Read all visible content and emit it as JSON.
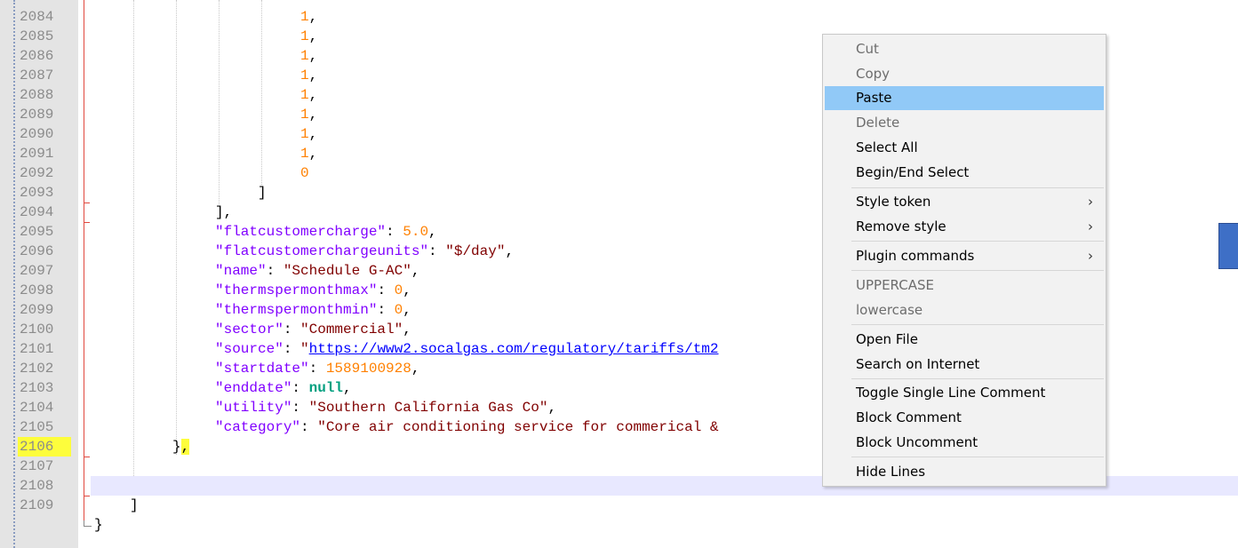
{
  "gutter": {
    "line_numbers": [
      "2084",
      "2085",
      "2086",
      "2087",
      "2088",
      "2089",
      "2090",
      "2091",
      "2092",
      "2093",
      "2094",
      "2095",
      "2096",
      "2097",
      "2098",
      "2099",
      "2100",
      "2101",
      "2102",
      "2103",
      "2104",
      "2105",
      "2106",
      "2107",
      "2108",
      "2109"
    ]
  },
  "code": {
    "l2084": "1",
    "l2085": "1",
    "l2086": "1",
    "l2087": "1",
    "l2088": "1",
    "l2089": "1",
    "l2090": "1",
    "l2091": "1",
    "l2092": "0",
    "l2093": "]",
    "l2094": "],",
    "l2095_key": "\"flatcustomercharge\"",
    "l2095_val": "5.0",
    "l2096_key": "\"flatcustomerchargeunits\"",
    "l2096_val": "\"$/day\"",
    "l2097_key": "\"name\"",
    "l2097_val": "\"Schedule G-AC\"",
    "l2098_key": "\"thermspermonthmax\"",
    "l2098_val": "0",
    "l2099_key": "\"thermspermonthmin\"",
    "l2099_val": "0",
    "l2100_key": "\"sector\"",
    "l2100_val": "\"Commercial\"",
    "l2101_key": "\"source\"",
    "l2101_q": "\"",
    "l2101_url": "https://www2.socalgas.com/regulatory/tariffs/tm2",
    "l2102_key": "\"startdate\"",
    "l2102_val": "1589100928",
    "l2103_key": "\"enddate\"",
    "l2103_val": "null",
    "l2104_key": "\"utility\"",
    "l2104_val": "\"Southern California Gas Co\"",
    "l2105_key": "\"category\"",
    "l2105_val": "\"Core air conditioning service for commerical &",
    "l2106_brace": "}",
    "l2106_comma": ",",
    "l2108": "]",
    "l2109": "}"
  },
  "context_menu": {
    "items": [
      {
        "label": "Cut",
        "enabled": false
      },
      {
        "label": "Copy",
        "enabled": false
      },
      {
        "label": "Paste",
        "enabled": true,
        "selected": true
      },
      {
        "label": "Delete",
        "enabled": false
      },
      {
        "label": "Select All",
        "enabled": true
      },
      {
        "label": "Begin/End Select",
        "enabled": true
      },
      {
        "label": "Style token",
        "enabled": true,
        "submenu": true
      },
      {
        "label": "Remove style",
        "enabled": true,
        "submenu": true
      },
      {
        "label": "Plugin commands",
        "enabled": true,
        "submenu": true
      },
      {
        "label": "UPPERCASE",
        "enabled": false
      },
      {
        "label": "lowercase",
        "enabled": false
      },
      {
        "label": "Open File",
        "enabled": true
      },
      {
        "label": "Search on Internet",
        "enabled": true
      },
      {
        "label": "Toggle Single Line Comment",
        "enabled": true
      },
      {
        "label": "Block Comment",
        "enabled": true
      },
      {
        "label": "Block Uncomment",
        "enabled": true
      },
      {
        "label": "Hide Lines",
        "enabled": true
      }
    ],
    "submenu_arrow": "›"
  },
  "colors": {
    "key": "#8000ff",
    "string": "#800000",
    "number": "#ff8000",
    "keyword": "#009f7f",
    "url": "#0000ff",
    "selection": "#91c9f7",
    "highlight": "#fdfd3c"
  }
}
